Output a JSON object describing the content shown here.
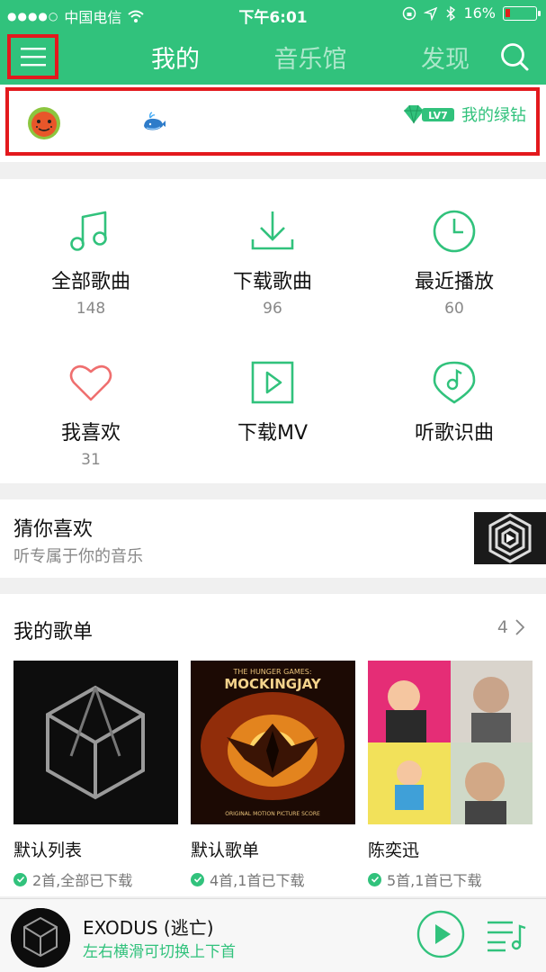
{
  "status_bar": {
    "carrier": "中国电信",
    "time": "下午6:01",
    "battery": "16%",
    "battery_level": 0.16
  },
  "header": {
    "tabs": [
      {
        "label": "我的",
        "active": true
      },
      {
        "label": "音乐馆",
        "active": false
      },
      {
        "label": "发现",
        "active": false
      }
    ],
    "accent_color": "#31c27c",
    "highlight_color": "#e3191d"
  },
  "user": {
    "level_badge": "LV7",
    "vip_label": "我的绿钻"
  },
  "quick_grid": [
    {
      "label": "全部歌曲",
      "count": "148",
      "icon": "music-note-icon"
    },
    {
      "label": "下载歌曲",
      "count": "96",
      "icon": "download-icon"
    },
    {
      "label": "最近播放",
      "count": "60",
      "icon": "clock-icon"
    },
    {
      "label": "我喜欢",
      "count": "31",
      "icon": "heart-icon"
    },
    {
      "label": "下载MV",
      "count": "",
      "icon": "play-video-icon"
    },
    {
      "label": "听歌识曲",
      "count": "",
      "icon": "recognize-music-icon"
    }
  ],
  "guess": {
    "title": "猜你喜欢",
    "subtitle": "听专属于你的音乐"
  },
  "playlists": {
    "title": "我的歌单",
    "count": "4",
    "items": [
      {
        "name": "默认列表",
        "status": "2首,全部已下载"
      },
      {
        "name": "默认歌单",
        "status": "4首,1首已下载",
        "cover_title": "THE HUNGER GAMES:",
        "cover_subtitle": "MOCKINGJAY",
        "cover_footer": "ORIGINAL MOTION PICTURE SCORE"
      },
      {
        "name": "陈奕迅",
        "status": "5首,1首已下载"
      }
    ]
  },
  "player": {
    "song": "EXODUS (逃亡)",
    "hint": "左右横滑可切换上下首"
  }
}
